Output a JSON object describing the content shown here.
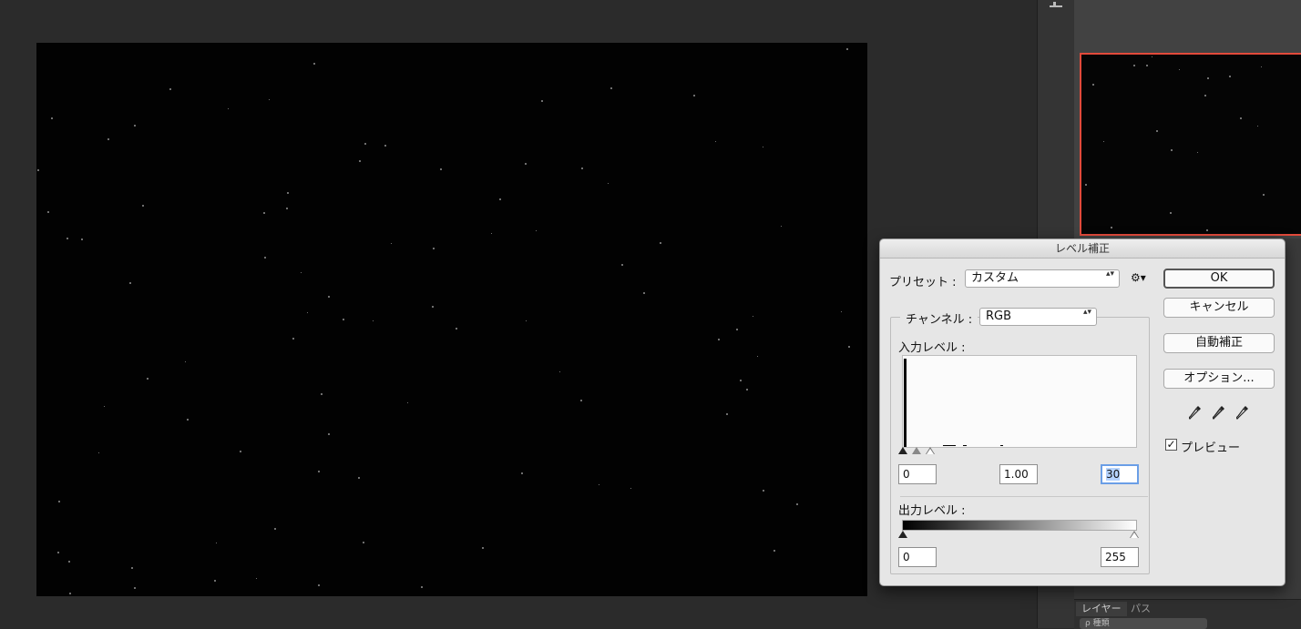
{
  "dialog": {
    "title": "レベル補正",
    "preset_label": "プリセット :",
    "preset_value": "カスタム",
    "channel_label": "チャンネル :",
    "channel_value": "RGB",
    "input_levels_label": "入力レベル :",
    "input_black": "0",
    "input_gamma": "1.00",
    "input_white": "30",
    "output_levels_label": "出力レベル :",
    "output_black": "0",
    "output_white": "255",
    "buttons": {
      "ok": "OK",
      "cancel": "キャンセル",
      "auto": "自動補正",
      "options": "オプション..."
    },
    "preview_label": "プレビュー",
    "preview_checked": "✓",
    "gear_glyph": "⚙▾",
    "select_arrows": "▴▾"
  },
  "panels": {
    "layers_tab": "レイヤー",
    "paths_tab": "パス",
    "search_placeholder": "ρ 種類"
  },
  "colors": {
    "selection_border": "#e24a3b",
    "focus_ring": "#6a9ee6"
  }
}
